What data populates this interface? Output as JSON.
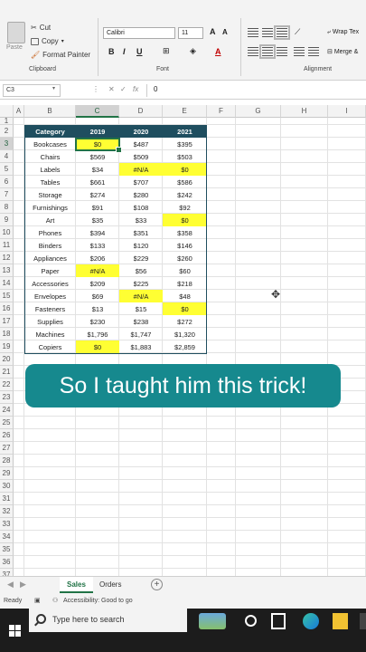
{
  "ribbon": {
    "clipboard": {
      "paste": "Paste",
      "cut": "Cut",
      "copy": "Copy",
      "format_painter": "Format Painter",
      "group_label": "Clipboard"
    },
    "font": {
      "font_name": "Calibri",
      "font_size": "11",
      "bold": "B",
      "italic": "I",
      "underline": "U",
      "grow": "A",
      "shrink": "A",
      "font_color": "A",
      "group_label": "Font"
    },
    "alignment": {
      "wrap_text": "Wrap Tex",
      "merge": "Merge &",
      "group_label": "Alignment"
    }
  },
  "formula_bar": {
    "name_box": "C3",
    "fx": "fx",
    "value": "0"
  },
  "grid": {
    "columns": [
      "A",
      "B",
      "C",
      "D",
      "E",
      "F",
      "G",
      "H",
      "I"
    ],
    "rows": [
      "1",
      "2",
      "3",
      "4",
      "5",
      "6",
      "7",
      "8",
      "9",
      "10",
      "11",
      "12",
      "13",
      "14",
      "15",
      "16",
      "17",
      "18",
      "19",
      "20",
      "21",
      "22",
      "23",
      "24",
      "25",
      "26",
      "27",
      "28",
      "29",
      "30",
      "31",
      "32",
      "33",
      "34",
      "35",
      "36",
      "37"
    ],
    "selected_cell": "C3"
  },
  "table": {
    "headers": [
      "Category",
      "2019",
      "2020",
      "2021"
    ],
    "rows": [
      {
        "category": "Bookcases",
        "v2019": "$0",
        "v2020": "$487",
        "v2021": "$395"
      },
      {
        "category": "Chairs",
        "v2019": "$569",
        "v2020": "$509",
        "v2021": "$503"
      },
      {
        "category": "Labels",
        "v2019": "$34",
        "v2020": "#N/A",
        "v2021": "$0"
      },
      {
        "category": "Tables",
        "v2019": "$661",
        "v2020": "$707",
        "v2021": "$586"
      },
      {
        "category": "Storage",
        "v2019": "$274",
        "v2020": "$280",
        "v2021": "$242"
      },
      {
        "category": "Furnishings",
        "v2019": "$91",
        "v2020": "$108",
        "v2021": "$92"
      },
      {
        "category": "Art",
        "v2019": "$35",
        "v2020": "$33",
        "v2021": "$0"
      },
      {
        "category": "Phones",
        "v2019": "$394",
        "v2020": "$351",
        "v2021": "$358"
      },
      {
        "category": "Binders",
        "v2019": "$133",
        "v2020": "$120",
        "v2021": "$146"
      },
      {
        "category": "Appliances",
        "v2019": "$206",
        "v2020": "$229",
        "v2021": "$260"
      },
      {
        "category": "Paper",
        "v2019": "#N/A",
        "v2020": "$56",
        "v2021": "$60"
      },
      {
        "category": "Accessories",
        "v2019": "$209",
        "v2020": "$225",
        "v2021": "$218"
      },
      {
        "category": "Envelopes",
        "v2019": "$69",
        "v2020": "#N/A",
        "v2021": "$48"
      },
      {
        "category": "Fasteners",
        "v2019": "$13",
        "v2020": "$15",
        "v2021": "$0"
      },
      {
        "category": "Supplies",
        "v2019": "$230",
        "v2020": "$238",
        "v2021": "$272"
      },
      {
        "category": "Machines",
        "v2019": "$1,796",
        "v2020": "$1,747",
        "v2021": "$1,320"
      },
      {
        "category": "Copiers",
        "v2019": "$0",
        "v2020": "$1,883",
        "v2021": "$2,859"
      }
    ],
    "highlight_color": "#ffff33",
    "header_color": "#1f4e5f"
  },
  "caption": {
    "text": "So I taught him this trick!",
    "color": "#16898e"
  },
  "sheets": {
    "tabs": [
      "Sales",
      "Orders"
    ],
    "active": "Sales",
    "add": "+"
  },
  "status": {
    "ready": "Ready",
    "accessibility": "Accessibility: Good to go"
  },
  "taskbar": {
    "search_placeholder": "Type here to search"
  }
}
